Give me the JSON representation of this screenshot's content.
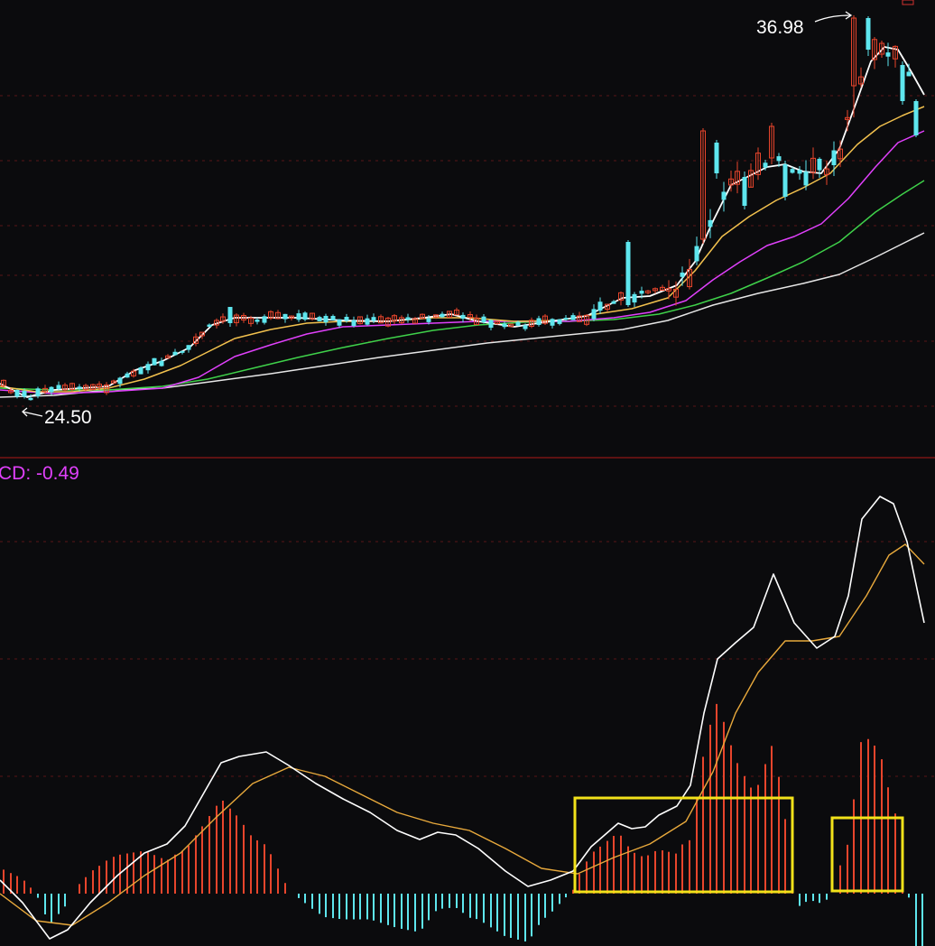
{
  "chart_data": [
    {
      "type": "candlestick",
      "panel": "price",
      "annotations": {
        "high_label": "36.98",
        "low_label": "24.50"
      },
      "colors": {
        "up": "#e8452c",
        "down": "#5ee6ee",
        "background": "#0b0b0d"
      },
      "ma_colors": [
        "#ffffff",
        "#f2c14e",
        "#e040fb",
        "#3fd14a",
        "#e6e6e6"
      ],
      "grid": true
    },
    {
      "type": "line",
      "panel": "macd",
      "indicator_label": "CD: -0.49",
      "colors": {
        "dif": "#ffffff",
        "dea": "#e8a93c",
        "hist_up": "#e8452c",
        "hist_down": "#5ee6ee",
        "label": "#e040fb"
      },
      "highlight_boxes": 2,
      "grid": true
    }
  ]
}
